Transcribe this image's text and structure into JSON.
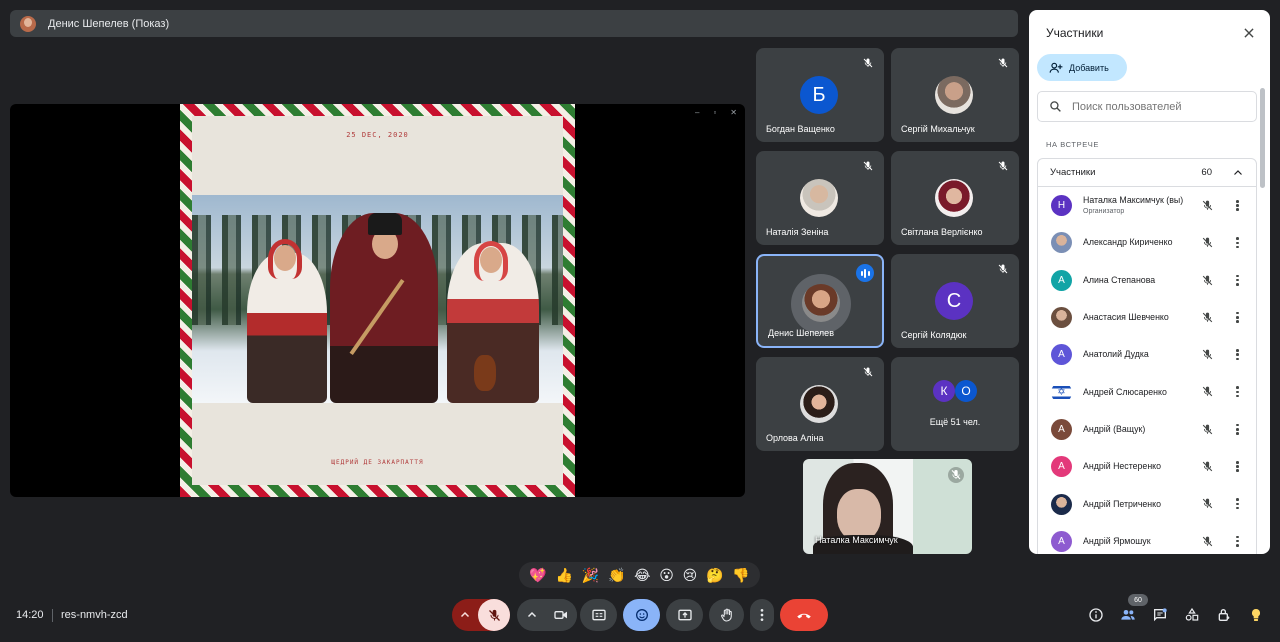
{
  "topbar": {
    "presenter_label": "Денис Шепелев (Показ)"
  },
  "presentation": {
    "date_text": "25 DEC, 2020",
    "footer_text": "ЩЕДРИЙ ДЕ ЗАКАРПАТТЯ",
    "window_buttons": [
      "–",
      "▫",
      "✕"
    ]
  },
  "tiles": [
    {
      "name": "Богдан Ващенко",
      "initial": "Б",
      "color": "#0b57d0",
      "type": "letter"
    },
    {
      "name": "Сергій Михальчук",
      "type": "photo"
    },
    {
      "name": "Наталія Зеніна",
      "type": "photo"
    },
    {
      "name": "Світлана Верлієнко",
      "type": "photo"
    },
    {
      "name": "Денис Шепелев",
      "type": "photo",
      "speaking": true
    },
    {
      "name": "Сергій Колядюк",
      "initial": "С",
      "color": "#5b32c2",
      "type": "letter"
    },
    {
      "name": "Орлова Аліна",
      "type": "photo"
    },
    {
      "name": "Ещё 51 чел.",
      "initial_a": "К",
      "initial_b": "О",
      "color_a": "#5b32c2",
      "color_b": "#0b57d0",
      "type": "more"
    }
  ],
  "self_tile": {
    "name": "Наталка Максимчук"
  },
  "panel": {
    "title": "Участники",
    "add_label": "Добавить",
    "search_placeholder": "Поиск пользователей",
    "section_label": "НА ВСТРЕЧЕ",
    "group_label": "Участники",
    "group_count": "60",
    "participants": [
      {
        "name": "Наталка Максимчук (вы)",
        "sub": "Организатор",
        "initial": "Н",
        "color": "#5b32c2"
      },
      {
        "name": "Александр Кириченко",
        "initial": "",
        "color": "#7b8fb5",
        "photo": true
      },
      {
        "name": "Алина Степанова",
        "initial": "А",
        "color": "#12a4a6"
      },
      {
        "name": "Анастасия Шевченко",
        "initial": "",
        "color": "#6b4f3f",
        "photo": true
      },
      {
        "name": "Анатолий Дудка",
        "initial": "А",
        "color": "#5e55d8"
      },
      {
        "name": "Андрей Слюсаренко",
        "initial": "✡",
        "color": "#ffffff",
        "flag": true
      },
      {
        "name": "Андрій (Ващук)",
        "initial": "А",
        "color": "#7a4a3a"
      },
      {
        "name": "Андрій Нестеренко",
        "initial": "А",
        "color": "#e3397a"
      },
      {
        "name": "Андрій Петриченко",
        "initial": "",
        "color": "#1b2a4a",
        "photo": true
      },
      {
        "name": "Андрій Ярмошук",
        "initial": "А",
        "color": "#8e5bd0"
      }
    ]
  },
  "reactions": [
    "💖",
    "👍",
    "🎉",
    "👏",
    "😂",
    "😮",
    "😢",
    "🤔",
    "👎"
  ],
  "bottom": {
    "time": "14:20",
    "meeting_code": "res-nmvh-zcd",
    "people_count": "60"
  },
  "colors": {
    "accent": "#8ab4f8",
    "end_call": "#ea4335",
    "active_button": "#8ab4f8",
    "mic_off": "#f9dedc"
  }
}
